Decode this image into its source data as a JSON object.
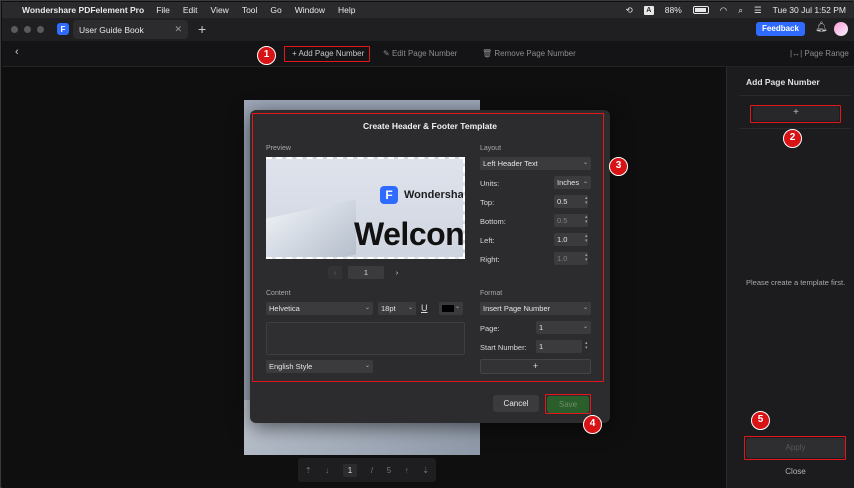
{
  "menubar": {
    "app_name": "Wondershare PDFelement Pro",
    "menus": [
      "File",
      "Edit",
      "View",
      "Tool",
      "Go",
      "Window",
      "Help"
    ],
    "input_source": "A",
    "battery": "88%",
    "datetime": "Tue 30 Jul  1:52 PM"
  },
  "tabs": {
    "document_title": "User Guide Book",
    "feedback_label": "Feedback"
  },
  "toolbar": {
    "add_page_number": "Add Page Number",
    "edit_page_number": "Edit Page Number",
    "remove_page_number": "Remove Page Number",
    "page_range": "Page Range"
  },
  "badges": [
    "1",
    "2",
    "3",
    "4",
    "5"
  ],
  "dialog": {
    "title": "Create Header & Footer Template",
    "preview_label": "Preview",
    "preview_brand": "Wondershare P",
    "preview_hero": "Welcon",
    "preview_page": "1",
    "layout_label": "Layout",
    "layout_value": "Left Header Text",
    "units_label": "Units:",
    "units_value": "Inches",
    "top_label": "Top:",
    "top_value": "0.5",
    "bottom_label": "Bottom:",
    "bottom_value": "0.5",
    "left_label": "Left:",
    "left_value": "1.0",
    "right_label": "Right:",
    "right_value": "1.0",
    "content_label": "Content",
    "font_value": "Helvetica",
    "size_value": "18pt",
    "underline_label": "U",
    "style_value": "English Style",
    "format_label": "Format",
    "format_value": "Insert Page Number",
    "page_label": "Page:",
    "page_value": "1",
    "start_number_label": "Start Number:",
    "start_number_value": "1",
    "add_label": "+",
    "cancel_label": "Cancel",
    "save_label": "Save"
  },
  "pagenav": {
    "current": "1",
    "separator": "/",
    "total": "5"
  },
  "panel": {
    "title": "Add Page Number",
    "add_label": "+",
    "message": "Please create a template first.",
    "apply_label": "Apply",
    "close_label": "Close"
  },
  "colors": {
    "accent": "#2f6bff",
    "highlight": "#e3161b",
    "badge": "#d71316",
    "save_button": "#2a5e2a"
  }
}
